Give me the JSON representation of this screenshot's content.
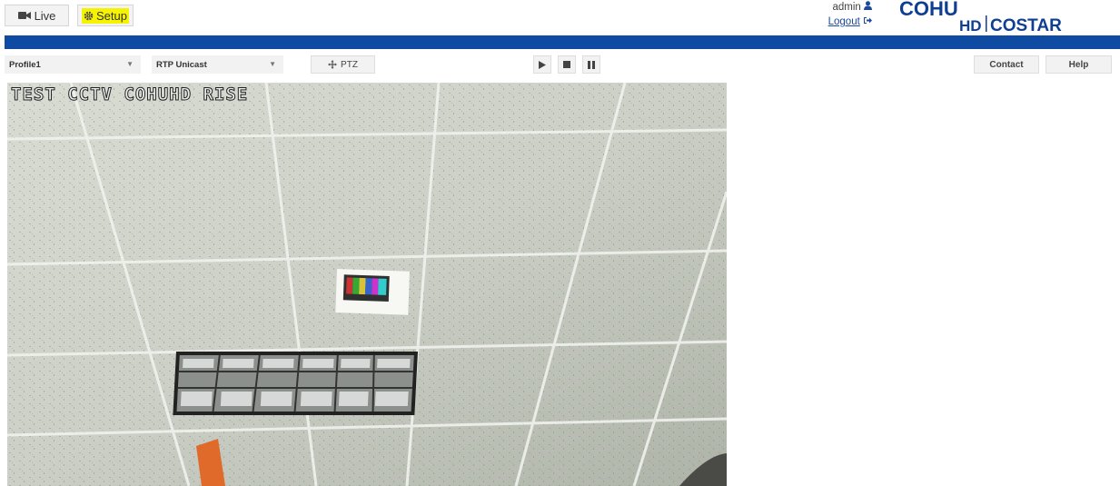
{
  "nav": {
    "live_label": "Live",
    "setup_label": "Setup"
  },
  "user": {
    "name": "admin",
    "logout_label": "Logout"
  },
  "logo": {
    "line1": "COHU",
    "hd": "HD",
    "line2": "COSTAR",
    "brand_color": "#0f3f93"
  },
  "controls": {
    "profile_value": "Profile1",
    "stream_value": "RTP Unicast",
    "ptz_label": "PTZ",
    "contact_label": "Contact",
    "help_label": "Help"
  },
  "video": {
    "osd_text": "TEST CCTV COHUHD RISE"
  },
  "colors": {
    "accent_bar": "#0f4aa3",
    "setup_highlight": "#f6f300"
  },
  "icons": {
    "live": "video-camera-icon",
    "setup": "gear-icon",
    "user": "user-icon",
    "logout": "sign-out-icon",
    "ptz": "arrows-icon",
    "play": "play-icon",
    "stop": "stop-icon",
    "pause": "pause-icon"
  }
}
